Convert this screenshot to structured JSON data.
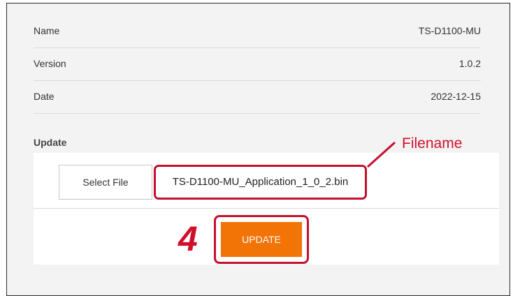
{
  "device_info": {
    "rows": [
      {
        "label": "Name",
        "value": "TS-D1100-MU"
      },
      {
        "label": "Version",
        "value": "1.0.2"
      },
      {
        "label": "Date",
        "value": "2022-12-15"
      }
    ]
  },
  "update": {
    "section_title": "Update",
    "select_file_label": "Select File",
    "selected_filename": "TS-D1100-MU_Application_1_0_2.bin",
    "update_button_label": "UPDATE"
  },
  "annotations": {
    "filename_callout": "Filename",
    "step_number": "4",
    "highlight_color": "#c4102e"
  },
  "colors": {
    "accent": "#f27406",
    "panel_background": "#f3f3f3"
  }
}
